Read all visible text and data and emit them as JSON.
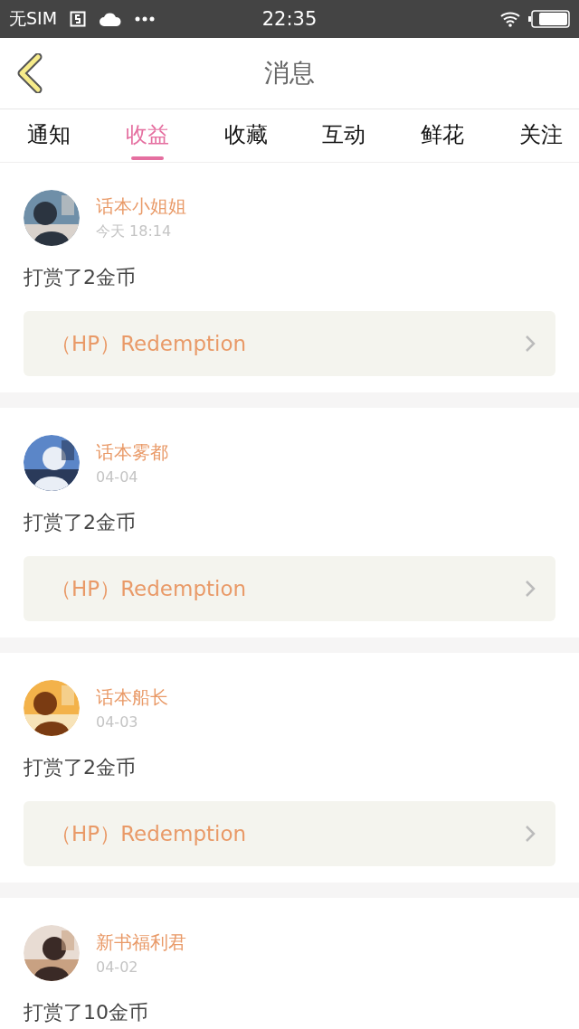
{
  "status_bar": {
    "carrier": "无SIM",
    "time": "22:35"
  },
  "header": {
    "title": "消息"
  },
  "tabs": [
    {
      "label": "通知",
      "selected": false
    },
    {
      "label": "收益",
      "selected": true
    },
    {
      "label": "收藏",
      "selected": false
    },
    {
      "label": "互动",
      "selected": false
    },
    {
      "label": "鲜花",
      "selected": false
    },
    {
      "label": "关注",
      "selected": false
    }
  ],
  "messages": [
    {
      "name": "话本小姐姐",
      "time": "今天 18:14",
      "text": "打赏了2金币",
      "link": "（HP）Redemption"
    },
    {
      "name": "话本雾都",
      "time": "04-04",
      "text": "打赏了2金币",
      "link": "（HP）Redemption"
    },
    {
      "name": "话本船长",
      "time": "04-03",
      "text": "打赏了2金币",
      "link": "（HP）Redemption"
    },
    {
      "name": "新书福利君",
      "time": "04-02",
      "text": "打赏了10金币"
    }
  ]
}
